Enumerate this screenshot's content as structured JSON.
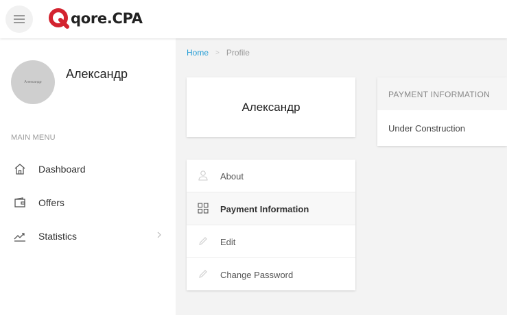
{
  "colors": {
    "brand_red": "#d3232f",
    "link_blue": "#2a9fd6",
    "page_background": "#f3f3f3"
  },
  "header": {
    "menu_icon": "hamburger-icon",
    "logo_text": "qore.CPA"
  },
  "sidebar": {
    "avatar_text": "Александр",
    "user_name": "Александр",
    "menu_heading": "MAIN MENU",
    "items": [
      {
        "label": "Dashboard",
        "icon": "home-icon"
      },
      {
        "label": "Offers",
        "icon": "wallet-icon"
      },
      {
        "label": "Statistics",
        "icon": "chart-line-icon",
        "has_submenu": true
      }
    ]
  },
  "breadcrumb": {
    "home": "Home",
    "separator": ">",
    "current": "Profile"
  },
  "profile_card": {
    "name": "Александр"
  },
  "profile_menu": {
    "items": [
      {
        "label": "About",
        "icon": "user-icon",
        "active": false
      },
      {
        "label": "Payment Information",
        "icon": "grid-icon",
        "active": true
      },
      {
        "label": "Edit",
        "icon": "pencil-icon",
        "active": false
      },
      {
        "label": "Change Password",
        "icon": "pencil-icon",
        "active": false
      }
    ]
  },
  "payment_panel": {
    "title": "PAYMENT INFORMATION",
    "body": "Under Construction"
  }
}
